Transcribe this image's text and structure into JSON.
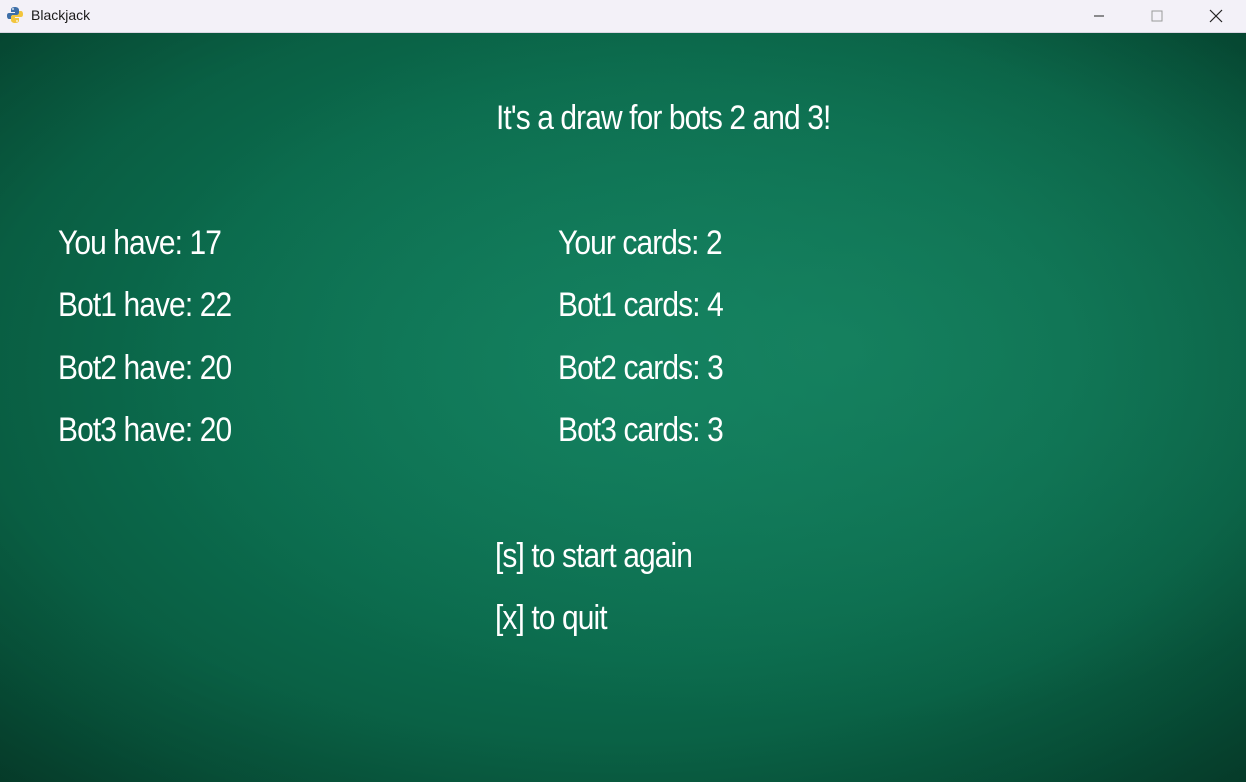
{
  "window": {
    "title": "Blackjack",
    "controls": {
      "minimize": "minimize-icon",
      "maximize": "maximize-icon",
      "close": "close-icon"
    }
  },
  "game": {
    "result_message": "It's a draw for bots 2 and 3!",
    "scores": [
      "You have: 17",
      "Bot1 have: 22",
      "Bot2 have: 20",
      "Bot3 have: 20"
    ],
    "cards": [
      "Your cards: 2",
      "Bot1 cards: 4",
      "Bot2 cards: 3",
      "Bot3 cards: 3"
    ],
    "options": {
      "restart": "[s] to start again",
      "quit": "[x] to quit"
    }
  },
  "colors": {
    "table_green": "#0b6a4c",
    "text": "#ffffff",
    "titlebar": "#f3f1f8"
  }
}
